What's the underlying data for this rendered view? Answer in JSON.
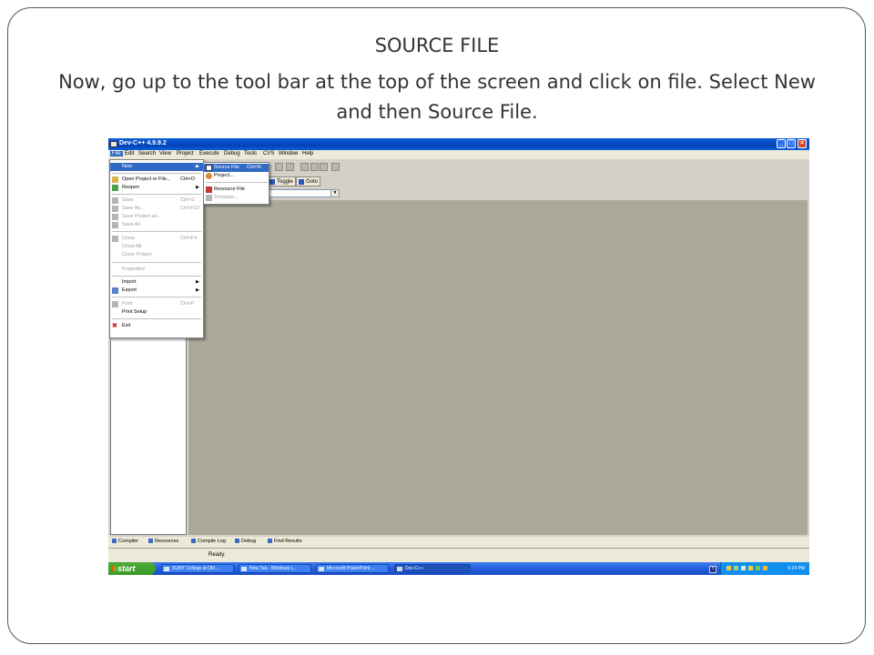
{
  "slide": {
    "title": "SOURCE FILE",
    "body": "Now, go up to the tool bar at the top of the screen and click on file. Select New and then Source File."
  },
  "window": {
    "title": "Dev-C++ 4.9.9.2",
    "controls": [
      "minimize",
      "maximize",
      "close"
    ]
  },
  "menubar": {
    "items": [
      "File",
      "Edit",
      "Search",
      "View",
      "Project",
      "Execute",
      "Debug",
      "Tools",
      "CVS",
      "Window",
      "Help"
    ],
    "active": "File"
  },
  "toolbar": {
    "toggle_label": "Toggle",
    "goto_label": "Goto"
  },
  "file_menu": {
    "items": [
      {
        "label": "New",
        "shortcut": "",
        "submenu": true,
        "icon": "none",
        "state": "highlighted"
      },
      {
        "label": "Open Project or File...",
        "shortcut": "Ctrl+O",
        "icon": "open-folder-icon",
        "state": "enabled"
      },
      {
        "label": "Reopen",
        "shortcut": "",
        "submenu": true,
        "icon": "reopen-arrow-icon",
        "state": "enabled"
      },
      {
        "label": "Save",
        "shortcut": "Ctrl+S",
        "icon": "save-icon",
        "state": "disabled"
      },
      {
        "label": "Save As...",
        "shortcut": "Ctrl+F12",
        "icon": "save-as-icon",
        "state": "disabled"
      },
      {
        "label": "Save Project as...",
        "shortcut": "",
        "icon": "save-project-icon",
        "state": "disabled"
      },
      {
        "label": "Save All",
        "shortcut": "",
        "icon": "save-all-icon",
        "state": "disabled"
      },
      {
        "label": "Close",
        "shortcut": "Ctrl+F4",
        "icon": "close-file-icon",
        "state": "disabled"
      },
      {
        "label": "Close All",
        "shortcut": "",
        "icon": "none",
        "state": "disabled"
      },
      {
        "label": "Close Project",
        "shortcut": "",
        "icon": "none",
        "state": "disabled"
      },
      {
        "label": "Properties",
        "shortcut": "",
        "icon": "none",
        "state": "disabled"
      },
      {
        "label": "Import",
        "shortcut": "",
        "submenu": true,
        "icon": "none",
        "state": "enabled"
      },
      {
        "label": "Export",
        "shortcut": "",
        "submenu": true,
        "icon": "export-icon",
        "state": "enabled"
      },
      {
        "label": "Print",
        "shortcut": "Ctrl+P",
        "icon": "print-icon",
        "state": "disabled"
      },
      {
        "label": "Print Setup",
        "shortcut": "",
        "icon": "none",
        "state": "enabled"
      },
      {
        "label": "Exit",
        "shortcut": "",
        "icon": "exit-x-icon",
        "state": "enabled"
      }
    ]
  },
  "new_submenu": {
    "items": [
      {
        "label": "Source File",
        "shortcut": "Ctrl+N",
        "icon": "source-file-icon",
        "state": "highlighted"
      },
      {
        "label": "Project...",
        "shortcut": "",
        "icon": "project-icon",
        "state": "enabled"
      },
      {
        "label": "Resource File",
        "shortcut": "",
        "icon": "resource-file-icon",
        "state": "enabled"
      },
      {
        "label": "Template...",
        "shortcut": "",
        "icon": "template-icon",
        "state": "disabled"
      }
    ]
  },
  "bottom_tabs": [
    "Compiler",
    "Resources",
    "Compile Log",
    "Debug",
    "Find Results"
  ],
  "status": {
    "text": "Ready."
  },
  "taskbar": {
    "start_label": "start",
    "tasks": [
      "SUNY College at Old ...",
      "New Tab - Windows I...",
      "Microsoft PowerPoint ...",
      "Dev-C++"
    ],
    "active_task": "Dev-C++",
    "clock": "6:24 PM"
  },
  "colors": {
    "highlight": "#316ac5",
    "titlebar": "#0442b7",
    "taskbar": "#245edb",
    "start_button": "#3b9a2a"
  }
}
